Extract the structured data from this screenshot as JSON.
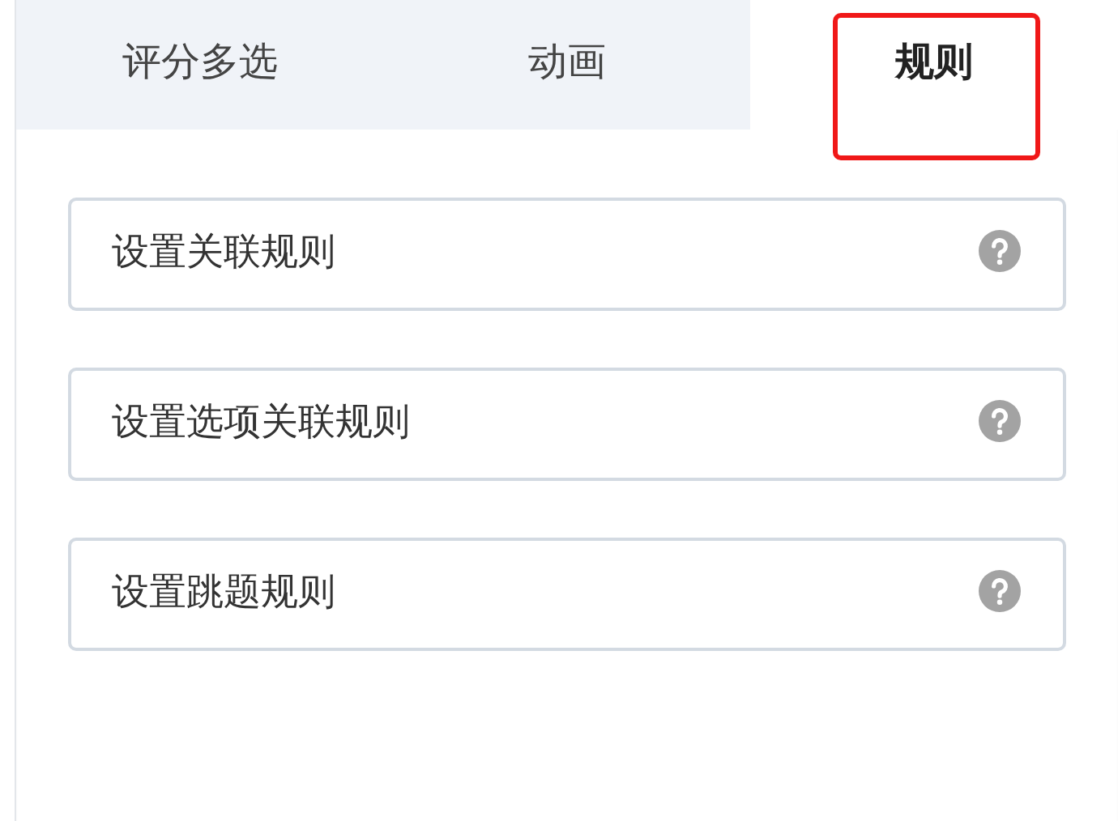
{
  "tabs": [
    {
      "label": "评分多选",
      "selected": false,
      "highlighted": false
    },
    {
      "label": "动画",
      "selected": false,
      "highlighted": false
    },
    {
      "label": "规则",
      "selected": true,
      "highlighted": true
    }
  ],
  "rules": [
    {
      "label": "设置关联规则"
    },
    {
      "label": "设置选项关联规则"
    },
    {
      "label": "设置跳题规则"
    }
  ]
}
